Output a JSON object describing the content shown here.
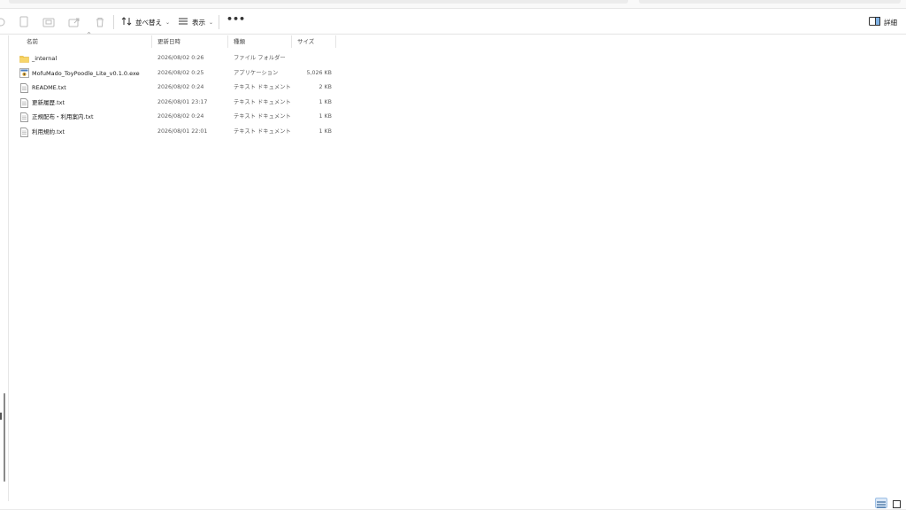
{
  "commandbar": {
    "sort_label": "並べ替え",
    "view_label": "表示",
    "more_label": "•••",
    "details_label": "詳細"
  },
  "columns": {
    "name": "名前",
    "date": "更新日時",
    "type": "種類",
    "size": "サイズ"
  },
  "files": [
    {
      "name": "_internal",
      "date": "2026/08/02 0:26",
      "type": "ファイル フォルダー",
      "size": "",
      "icon": "folder-icon"
    },
    {
      "name": "MofuMado_ToyPoodle_Lite_v0.1.0.exe",
      "date": "2026/08/02 0:25",
      "type": "アプリケーション",
      "size": "5,026 KB",
      "icon": "application-icon"
    },
    {
      "name": "README.txt",
      "date": "2026/08/02 0:24",
      "type": "テキスト ドキュメント",
      "size": "2 KB",
      "icon": "text-file-icon"
    },
    {
      "name": "更新履歴.txt",
      "date": "2026/08/01 23:17",
      "type": "テキスト ドキュメント",
      "size": "1 KB",
      "icon": "text-file-icon"
    },
    {
      "name": "正規配布・利用案内.txt",
      "date": "2026/08/02 0:24",
      "type": "テキスト ドキュメント",
      "size": "1 KB",
      "icon": "text-file-icon"
    },
    {
      "name": "利用規約.txt",
      "date": "2026/08/01 22:01",
      "type": "テキスト ドキュメント",
      "size": "1 KB",
      "icon": "text-file-icon"
    }
  ],
  "colors": {
    "folder": "#f2c94c",
    "accent": "#0067c0"
  }
}
